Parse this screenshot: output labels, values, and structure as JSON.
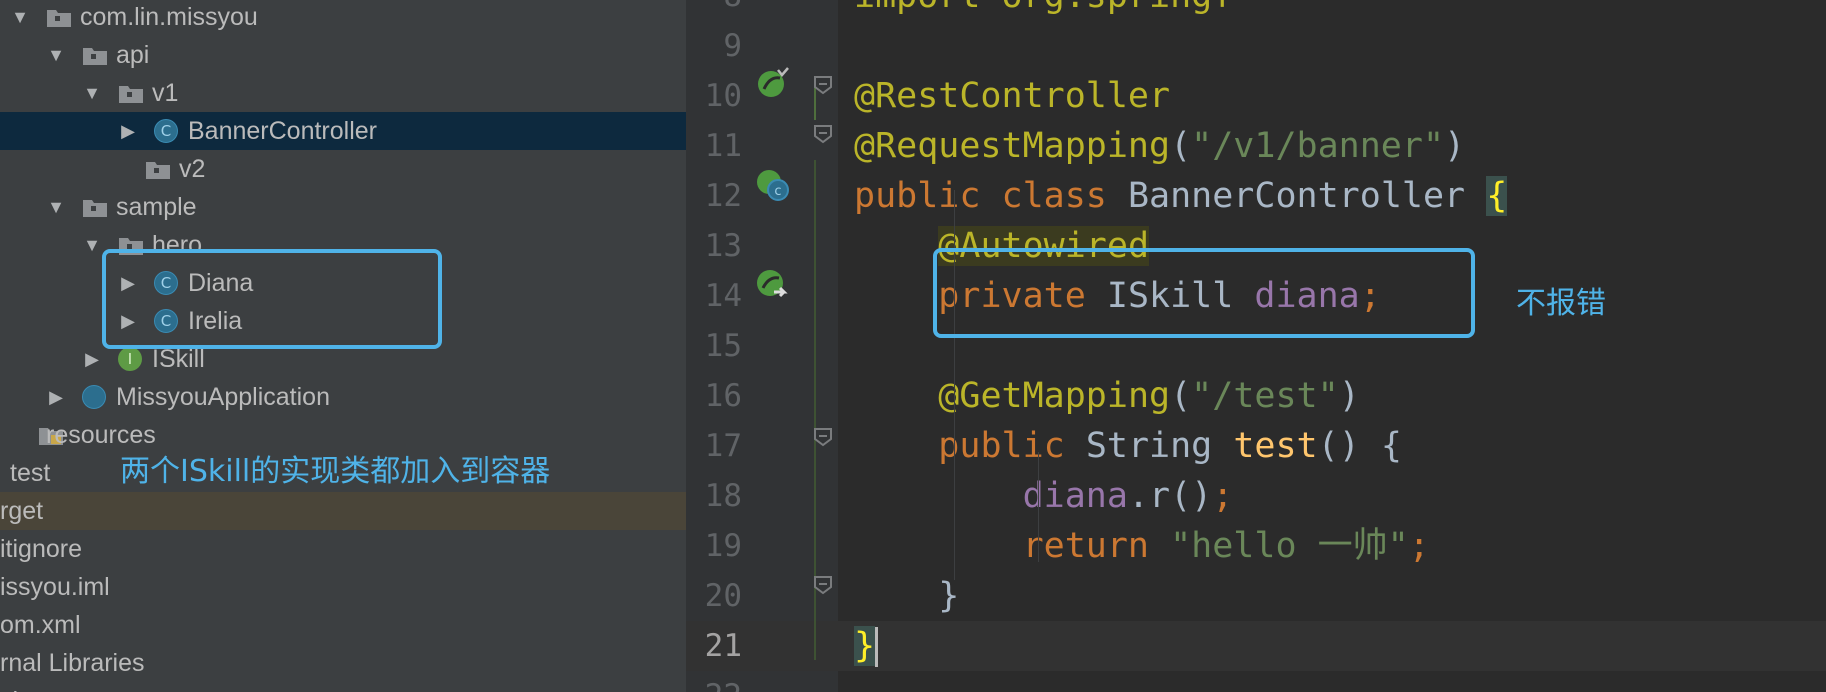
{
  "project_tree": {
    "rows": [
      {
        "label": "com.lin.missyou",
        "kind": "package",
        "expanded": true
      },
      {
        "label": "api",
        "kind": "package",
        "expanded": true
      },
      {
        "label": "v1",
        "kind": "package",
        "expanded": true
      },
      {
        "label": "BannerController",
        "kind": "class",
        "expanded": false,
        "selected": true
      },
      {
        "label": "v2",
        "kind": "package"
      },
      {
        "label": "sample",
        "kind": "package",
        "expanded": true
      },
      {
        "label": "hero",
        "kind": "package",
        "expanded": true
      },
      {
        "label": "Diana",
        "kind": "class",
        "expanded": false
      },
      {
        "label": "Irelia",
        "kind": "class",
        "expanded": false
      },
      {
        "label": "ISkill",
        "kind": "interface",
        "expanded": false
      },
      {
        "label": "MissyouApplication",
        "kind": "spring-app",
        "expanded": false
      },
      {
        "label": "resources",
        "kind": "resources-folder"
      },
      {
        "label": "test",
        "kind": "folder"
      },
      {
        "label": "rget",
        "kind": "folder",
        "highlighted": true
      },
      {
        "label": "itignore",
        "kind": "file"
      },
      {
        "label": "issyou.iml",
        "kind": "file"
      },
      {
        "label": "om.xml",
        "kind": "file"
      },
      {
        "label": "rnal Libraries",
        "kind": "library"
      },
      {
        "label": "ch",
        "kind": "misc"
      }
    ],
    "icon_letters": {
      "class": "C",
      "interface": "I"
    }
  },
  "editor": {
    "current_line": "21",
    "lines": [
      {
        "num": "8",
        "tokens": [
          {
            "t": "import org.springf",
            "c": "ann"
          }
        ]
      },
      {
        "num": "9",
        "tokens": []
      },
      {
        "num": "10",
        "tokens": [
          {
            "t": "@RestController",
            "c": "ann"
          }
        ]
      },
      {
        "num": "11",
        "tokens": [
          {
            "t": "@RequestMapping",
            "c": "ann"
          },
          {
            "t": "(",
            "c": "plain"
          },
          {
            "t": "\"/v1/banner\"",
            "c": "str"
          },
          {
            "t": ")",
            "c": "plain"
          }
        ]
      },
      {
        "num": "12",
        "tokens": [
          {
            "t": "public ",
            "c": "kw"
          },
          {
            "t": "class ",
            "c": "kw"
          },
          {
            "t": "BannerController ",
            "c": "plain"
          },
          {
            "t": "{",
            "c": "brace-hl"
          }
        ]
      },
      {
        "num": "13",
        "tokens": [
          {
            "t": "    ",
            "c": "plain"
          },
          {
            "t": "@Autowired",
            "c": "ann-hl"
          }
        ]
      },
      {
        "num": "14",
        "tokens": [
          {
            "t": "    ",
            "c": "plain"
          },
          {
            "t": "private ",
            "c": "kw"
          },
          {
            "t": "ISkill ",
            "c": "plain"
          },
          {
            "t": "diana",
            "c": "field"
          },
          {
            "t": ";",
            "c": "kw"
          }
        ]
      },
      {
        "num": "15",
        "tokens": []
      },
      {
        "num": "16",
        "tokens": [
          {
            "t": "    ",
            "c": "plain"
          },
          {
            "t": "@GetMapping",
            "c": "ann"
          },
          {
            "t": "(",
            "c": "plain"
          },
          {
            "t": "\"/test\"",
            "c": "str"
          },
          {
            "t": ")",
            "c": "plain"
          }
        ]
      },
      {
        "num": "17",
        "tokens": [
          {
            "t": "    ",
            "c": "plain"
          },
          {
            "t": "public ",
            "c": "kw"
          },
          {
            "t": "String ",
            "c": "plain"
          },
          {
            "t": "test",
            "c": "method"
          },
          {
            "t": "() {",
            "c": "plain"
          }
        ]
      },
      {
        "num": "18",
        "tokens": [
          {
            "t": "        ",
            "c": "plain"
          },
          {
            "t": "diana",
            "c": "field"
          },
          {
            "t": ".r()",
            "c": "plain"
          },
          {
            "t": ";",
            "c": "kw"
          }
        ]
      },
      {
        "num": "19",
        "tokens": [
          {
            "t": "        ",
            "c": "plain"
          },
          {
            "t": "return ",
            "c": "kw"
          },
          {
            "t": "\"hello 一帅\"",
            "c": "str"
          },
          {
            "t": ";",
            "c": "kw"
          }
        ]
      },
      {
        "num": "20",
        "tokens": [
          {
            "t": "    }",
            "c": "plain"
          }
        ]
      },
      {
        "num": "21",
        "tokens": [
          {
            "t": "}",
            "c": "brace-hl"
          }
        ]
      },
      {
        "num": "22",
        "tokens": []
      }
    ]
  },
  "annotations": {
    "left_note": "两个ISkill的实现类都加入到容器",
    "right_note": "不报错"
  },
  "colors": {
    "accent_box": "#4fb3e8",
    "annotation": "#bbb529",
    "keyword": "#cc7832",
    "string": "#6a8759",
    "field": "#9876aa",
    "method": "#ffc66d"
  }
}
